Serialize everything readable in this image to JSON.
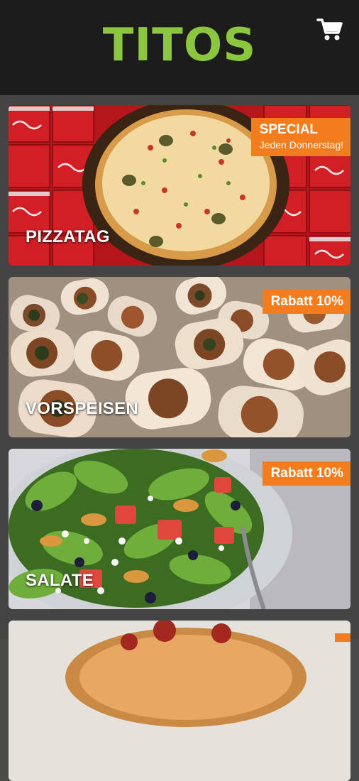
{
  "header": {
    "logo_text": "TITOS",
    "logo_color": "#8cc63f",
    "cart_icon": "cart-icon"
  },
  "categories": [
    {
      "label": "PIZZATAG",
      "badge_title": "SPECIAL",
      "badge_sub": "Jeden Donnerstag!",
      "badge_color": "#f37d1d"
    },
    {
      "label": "VORSPEISEN",
      "badge_title": "Rabatt 10%",
      "badge_color": "#f37d1d"
    },
    {
      "label": "SALATE",
      "badge_title": "Rabatt 10%",
      "badge_color": "#f37d1d"
    }
  ]
}
